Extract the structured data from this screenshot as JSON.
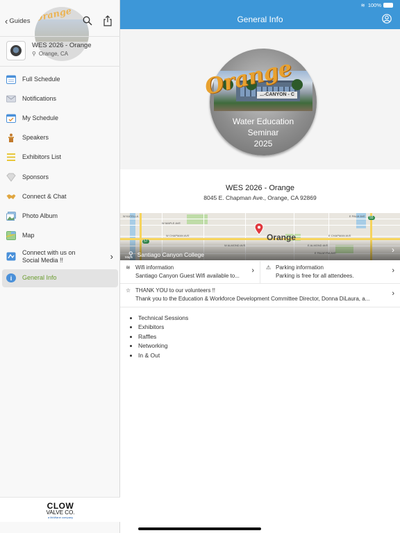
{
  "sidebar": {
    "back_label": "Guides",
    "event": {
      "title": "WES 2026 - Orange",
      "location": "Orange, CA",
      "ghost_logo_text": "Orange"
    },
    "items": [
      {
        "label": "Full Schedule",
        "icon": "calendar-icon",
        "color": "#4a90d9"
      },
      {
        "label": "Notifications",
        "icon": "envelope-icon",
        "color": "#c8ccd6"
      },
      {
        "label": "My Schedule",
        "icon": "calendar-check-icon",
        "color": "#4a90d9"
      },
      {
        "label": "Speakers",
        "icon": "podium-icon",
        "color": "#c27a2c"
      },
      {
        "label": "Exhibitors List",
        "icon": "list-icon",
        "color": "#e8c63a"
      },
      {
        "label": "Sponsors",
        "icon": "diamond-icon",
        "color": "#d6d6d6"
      },
      {
        "label": "Connect & Chat",
        "icon": "handshake-icon",
        "color": "#e0a640"
      },
      {
        "label": "Photo Album",
        "icon": "photo-icon",
        "color": "#6aa16a"
      },
      {
        "label": "Map",
        "icon": "map-icon",
        "color": "#6fb36b"
      },
      {
        "label": "Connect with us on Social Media !!",
        "icon": "social-icon",
        "color": "#4a90d9"
      },
      {
        "label": "General Info",
        "icon": "info-icon",
        "color": "#4a90d9"
      }
    ],
    "sponsor": {
      "line1": "CLOW",
      "line2": "VALVE CO.",
      "line3": "a McWane company"
    }
  },
  "status_bar": {
    "battery": "100%"
  },
  "header": {
    "title": "General Info"
  },
  "hero": {
    "orange_word": "Orange",
    "sign_text": "...-CANYON - C",
    "line1": "Water Education",
    "line2": "Seminar",
    "line3": "2025"
  },
  "event": {
    "name": "WES 2026 - Orange",
    "address": "8045 E. Chapman Ave., Orange, CA 92869"
  },
  "map": {
    "city_label": "Orange",
    "place_name": "Santiago Canyon College",
    "provider": "Maps",
    "streets": [
      "W KATELLA",
      "E PALM AVE",
      "W MAPLE AVE",
      "W CHAPMAN AVE",
      "E CHAPMAN AVE",
      "W ALMOND AVE",
      "E ALMOND AVE",
      "E PALMYRA AVE"
    ],
    "highways": [
      "57",
      "55"
    ]
  },
  "info_cards": [
    {
      "title": "Wifi information",
      "body": "Santiago Canyon Guest Wifi available to...",
      "icon": "wifi-icon"
    },
    {
      "title": "Parking information",
      "body": "Parking is free for all attendees.",
      "icon": "warning-icon"
    }
  ],
  "volunteer_card": {
    "title": "THANK YOU to our volunteers !!",
    "body": "Thank you to the Education & Workforce Development Committee Director, Donna DiLaura, a...",
    "icon": "star-icon"
  },
  "bullets": [
    "Technical Sessions",
    "Exhibitors",
    "Raffles",
    "Networking",
    "In & Out"
  ]
}
